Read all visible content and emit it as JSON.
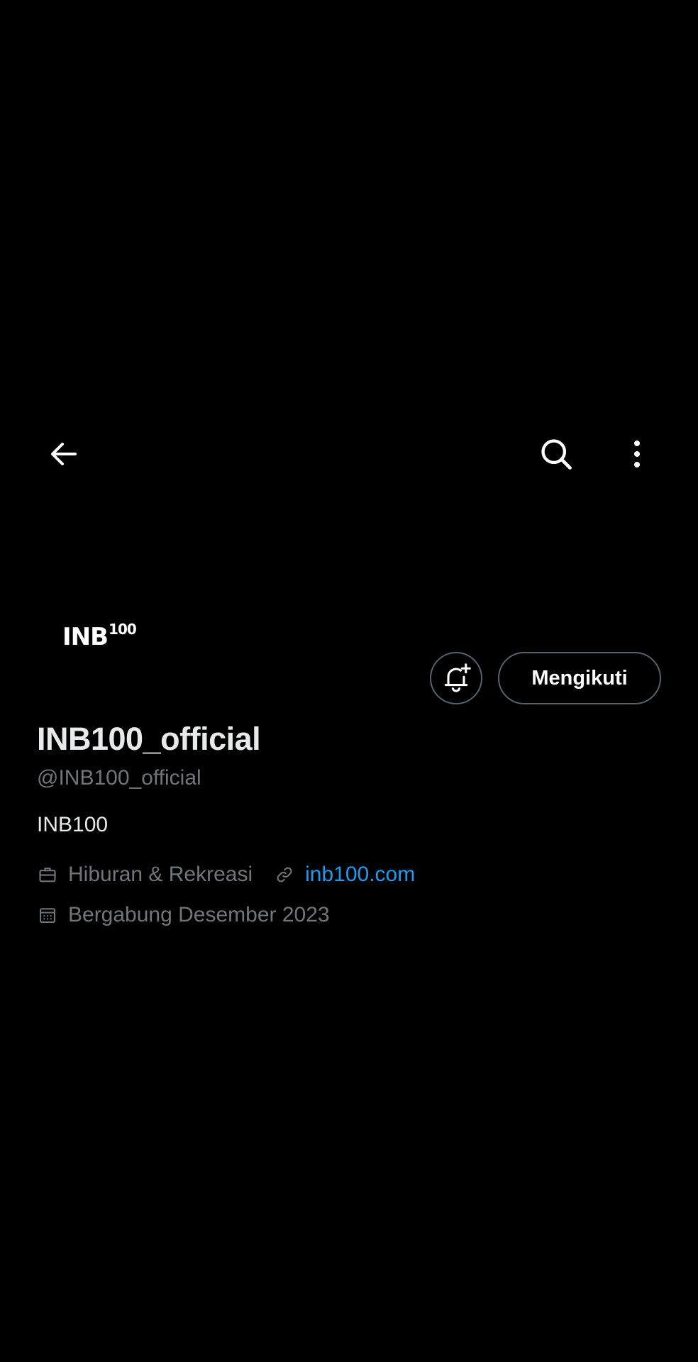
{
  "header": {
    "back_icon": "arrow-left-icon",
    "search_icon": "search-icon",
    "more_icon": "more-vertical-icon"
  },
  "profile": {
    "avatar": {
      "logo_text": "INB",
      "logo_sup": "100"
    },
    "display_name": "INB100_official",
    "handle": "@INB100_official",
    "bio": "INB100",
    "category": "Hiburan & Rekreasi",
    "website": "inb100.com",
    "joined": "Bergabung Desember 2023"
  },
  "actions": {
    "notify_icon": "bell-plus-icon",
    "follow_label": "Mengikuti"
  },
  "colors": {
    "background": "#000000",
    "primary_text": "#e7e9ea",
    "secondary_text": "#71767b",
    "link": "#1d9bf0",
    "border": "#536471"
  }
}
